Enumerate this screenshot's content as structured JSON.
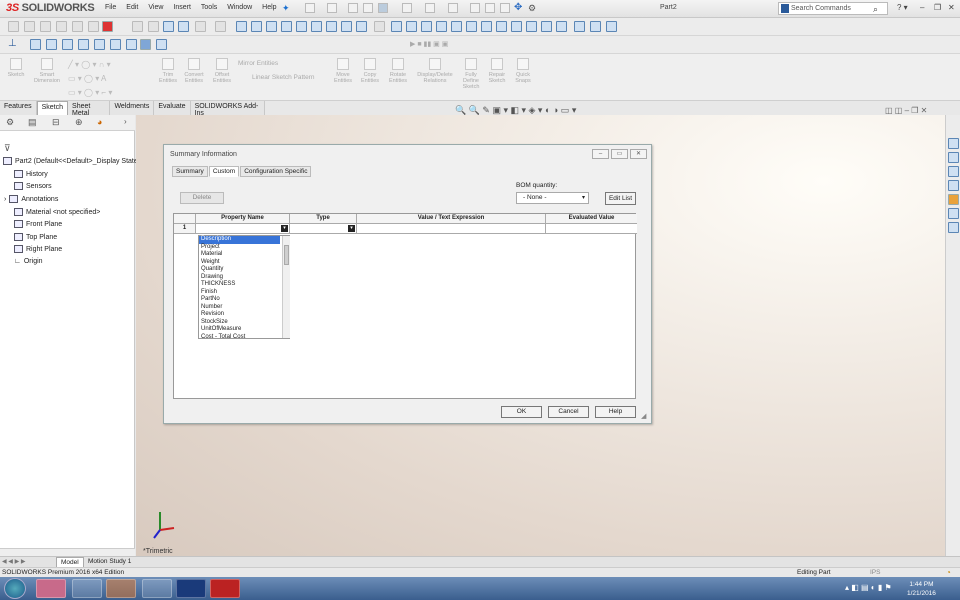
{
  "app": {
    "brand": "SOLIDWORKS",
    "brand_prefix": "3S",
    "doc_title": "Part2"
  },
  "menu": [
    "File",
    "Edit",
    "View",
    "Insert",
    "Tools",
    "Window",
    "Help"
  ],
  "search": {
    "placeholder": "Search Commands"
  },
  "ribbon": [
    "Sketch",
    "Smart Dimension",
    "Trim Entities",
    "Convert Entities",
    "Offset Entities",
    "Mirror Entities",
    "Linear Sketch Pattern",
    "Move Entities",
    "Copy Entities",
    "Rotate Entities",
    "Display/Delete Relations",
    "Fully Define Sketch",
    "Repair Sketch",
    "Quick Snaps"
  ],
  "cmd_tabs": [
    "Features",
    "Sketch",
    "Sheet Metal",
    "Weldments",
    "Evaluate",
    "SOLIDWORKS Add-Ins"
  ],
  "tree": {
    "root": "Part2 (Default<<Default>_Display State",
    "items": [
      "History",
      "Sensors",
      "Annotations",
      "Material <not specified>",
      "Front Plane",
      "Top Plane",
      "Right Plane",
      "Origin"
    ]
  },
  "dialog": {
    "title": "Summary Information",
    "tabs": [
      "Summary",
      "Custom",
      "Configuration Specific"
    ],
    "delete_label": "Delete",
    "bom_label": "BOM quantity:",
    "bom_value": "- None -",
    "edit_list": "Edit List",
    "columns": [
      "Property Name",
      "Type",
      "Value / Text Expression",
      "Evaluated Value"
    ],
    "row_num": "1",
    "property_options": [
      "Description",
      "Project",
      "Material",
      "Weight",
      "Quantity",
      "Drawing",
      "THICKNESS",
      "Finish",
      "PartNo",
      "Number",
      "Revision",
      "StockSize",
      "UnitOfMeasure",
      "Cost - Total Cost"
    ],
    "ok": "OK",
    "cancel": "Cancel",
    "help": "Help"
  },
  "view_label": "*Trimetric",
  "bottom_tabs": [
    "Model",
    "Motion Study 1"
  ],
  "status": {
    "left": "SOLIDWORKS Premium 2016 x64 Edition",
    "mode": "Editing Part",
    "units": "IPS"
  },
  "taskbar": {
    "time": "1:44 PM",
    "date": "1/21/2016"
  },
  "colors": {
    "brand_red": "#d22222",
    "selection_blue": "#3874d8",
    "taskbar": "#3a5e8e"
  }
}
